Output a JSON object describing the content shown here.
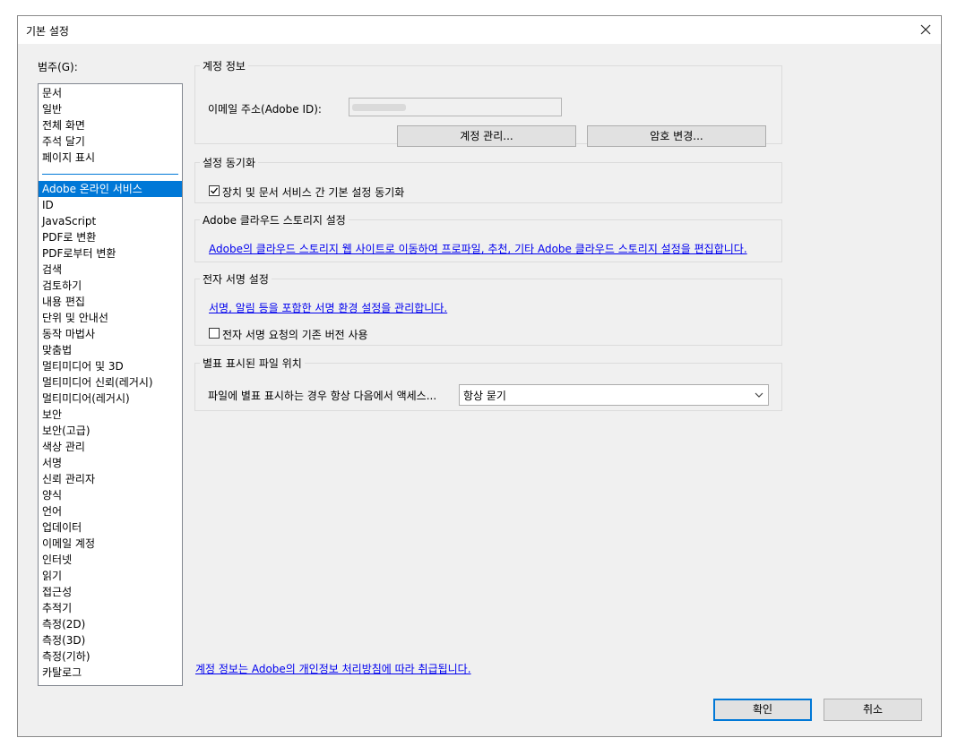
{
  "window": {
    "title": "기본 설정"
  },
  "categories": {
    "label": "범주(G):",
    "top_items": [
      "문서",
      "일반",
      "전체 화면",
      "주석 달기",
      "페이지 표시"
    ],
    "items": [
      "Adobe 온라인 서비스",
      "ID",
      "JavaScript",
      "PDF로 변환",
      "PDF로부터 변환",
      "검색",
      "검토하기",
      "내용 편집",
      "단위 및 안내선",
      "동작 마법사",
      "맞춤법",
      "멀티미디어 및 3D",
      "멀티미디어 신뢰(레거시)",
      "멀티미디어(레거시)",
      "보안",
      "보안(고급)",
      "색상 관리",
      "서명",
      "신뢰 관리자",
      "양식",
      "언어",
      "업데이터",
      "이메일 계정",
      "인터넷",
      "읽기",
      "접근성",
      "추적기",
      "측정(2D)",
      "측정(3D)",
      "측정(기하)",
      "카탈로그"
    ],
    "selected": "Adobe 온라인 서비스"
  },
  "account": {
    "legend": "계정 정보",
    "email_label": "이메일 주소(Adobe ID):",
    "manage_button": "계정 관리...",
    "password_button": "암호 변경..."
  },
  "sync": {
    "legend": "설정 동기화",
    "checkbox_label": "장치 및 문서 서비스 간 기본 설정 동기화",
    "checked": true
  },
  "cloud": {
    "legend": "Adobe 클라우드 스토리지 설정",
    "link": "Adobe의 클라우드 스토리지 웹 사이트로 이동하여 프로파일, 추천, 기타 Adobe 클라우드 스토리지 설정을 편집합니다."
  },
  "esign": {
    "legend": "전자 서명 설정",
    "link": "서명, 알림 등을 포함한 서명 환경 설정을 관리합니다.",
    "checkbox_label": "전자 서명 요청의 기존 버전 사용",
    "checked": false
  },
  "starred": {
    "legend": "별표 표시된 파일 위치",
    "label": "파일에 별표 표시하는 경우 항상 다음에서 액세스...",
    "selected": "항상 묻기"
  },
  "footer": {
    "privacy_link": "계정 정보는 Adobe의 개인정보 처리방침에 따라 취급됩니다.",
    "ok_button": "확인",
    "cancel_button": "취소"
  }
}
